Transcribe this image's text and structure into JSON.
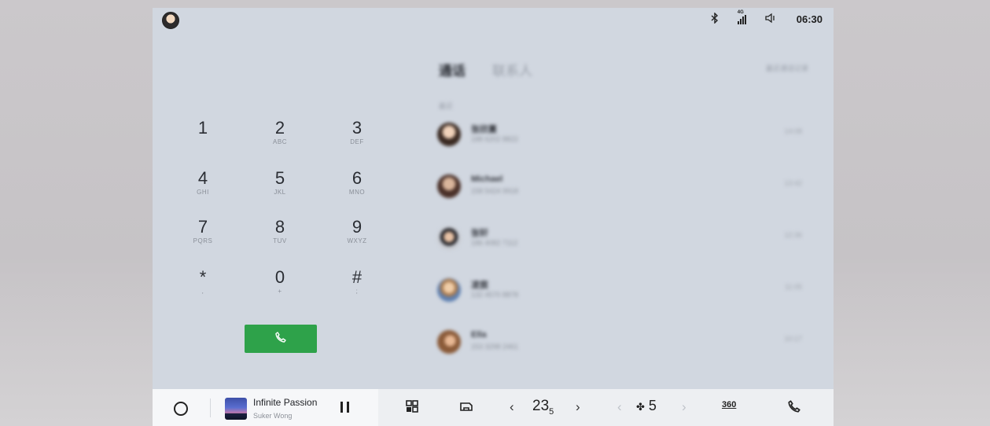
{
  "status": {
    "time": "06:30",
    "network": "4G",
    "icons": [
      "bluetooth-icon",
      "signal-icon",
      "volume-icon"
    ]
  },
  "dialpad": {
    "keys": [
      {
        "digit": "1",
        "letters": ""
      },
      {
        "digit": "2",
        "letters": "ABC"
      },
      {
        "digit": "3",
        "letters": "DEF"
      },
      {
        "digit": "4",
        "letters": "GHI"
      },
      {
        "digit": "5",
        "letters": "JKL"
      },
      {
        "digit": "6",
        "letters": "MNO"
      },
      {
        "digit": "7",
        "letters": "PQRS"
      },
      {
        "digit": "8",
        "letters": "TUV"
      },
      {
        "digit": "9",
        "letters": "WXYZ"
      },
      {
        "digit": "*",
        "letters": ","
      },
      {
        "digit": "0",
        "letters": "+"
      },
      {
        "digit": "#",
        "letters": ";"
      }
    ],
    "call_icon": "phone-icon",
    "call_color": "#2ea24a"
  },
  "calls": {
    "tabs": [
      "通话",
      "联系人"
    ],
    "right_label": "最近通话记录",
    "section": "最近",
    "items": [
      {
        "name": "张欣蔓",
        "number": "188 6202 8822",
        "time": "14:08"
      },
      {
        "name": "Michael",
        "number": "158 5424 9918",
        "time": "13:42"
      },
      {
        "name": "张轩",
        "number": "186 4082 7112",
        "time": "12:36"
      },
      {
        "name": "凌宸",
        "number": "132 4570 8878",
        "time": "11:05"
      },
      {
        "name": "Ella",
        "number": "153 3298 2461",
        "time": "10:17"
      }
    ]
  },
  "dock": {
    "media": {
      "title": "Infinite Passion",
      "artist": "Suker Wong"
    },
    "temperature": "23",
    "temperature_decimal": "5",
    "fan_level": "5",
    "view_label": "360"
  }
}
